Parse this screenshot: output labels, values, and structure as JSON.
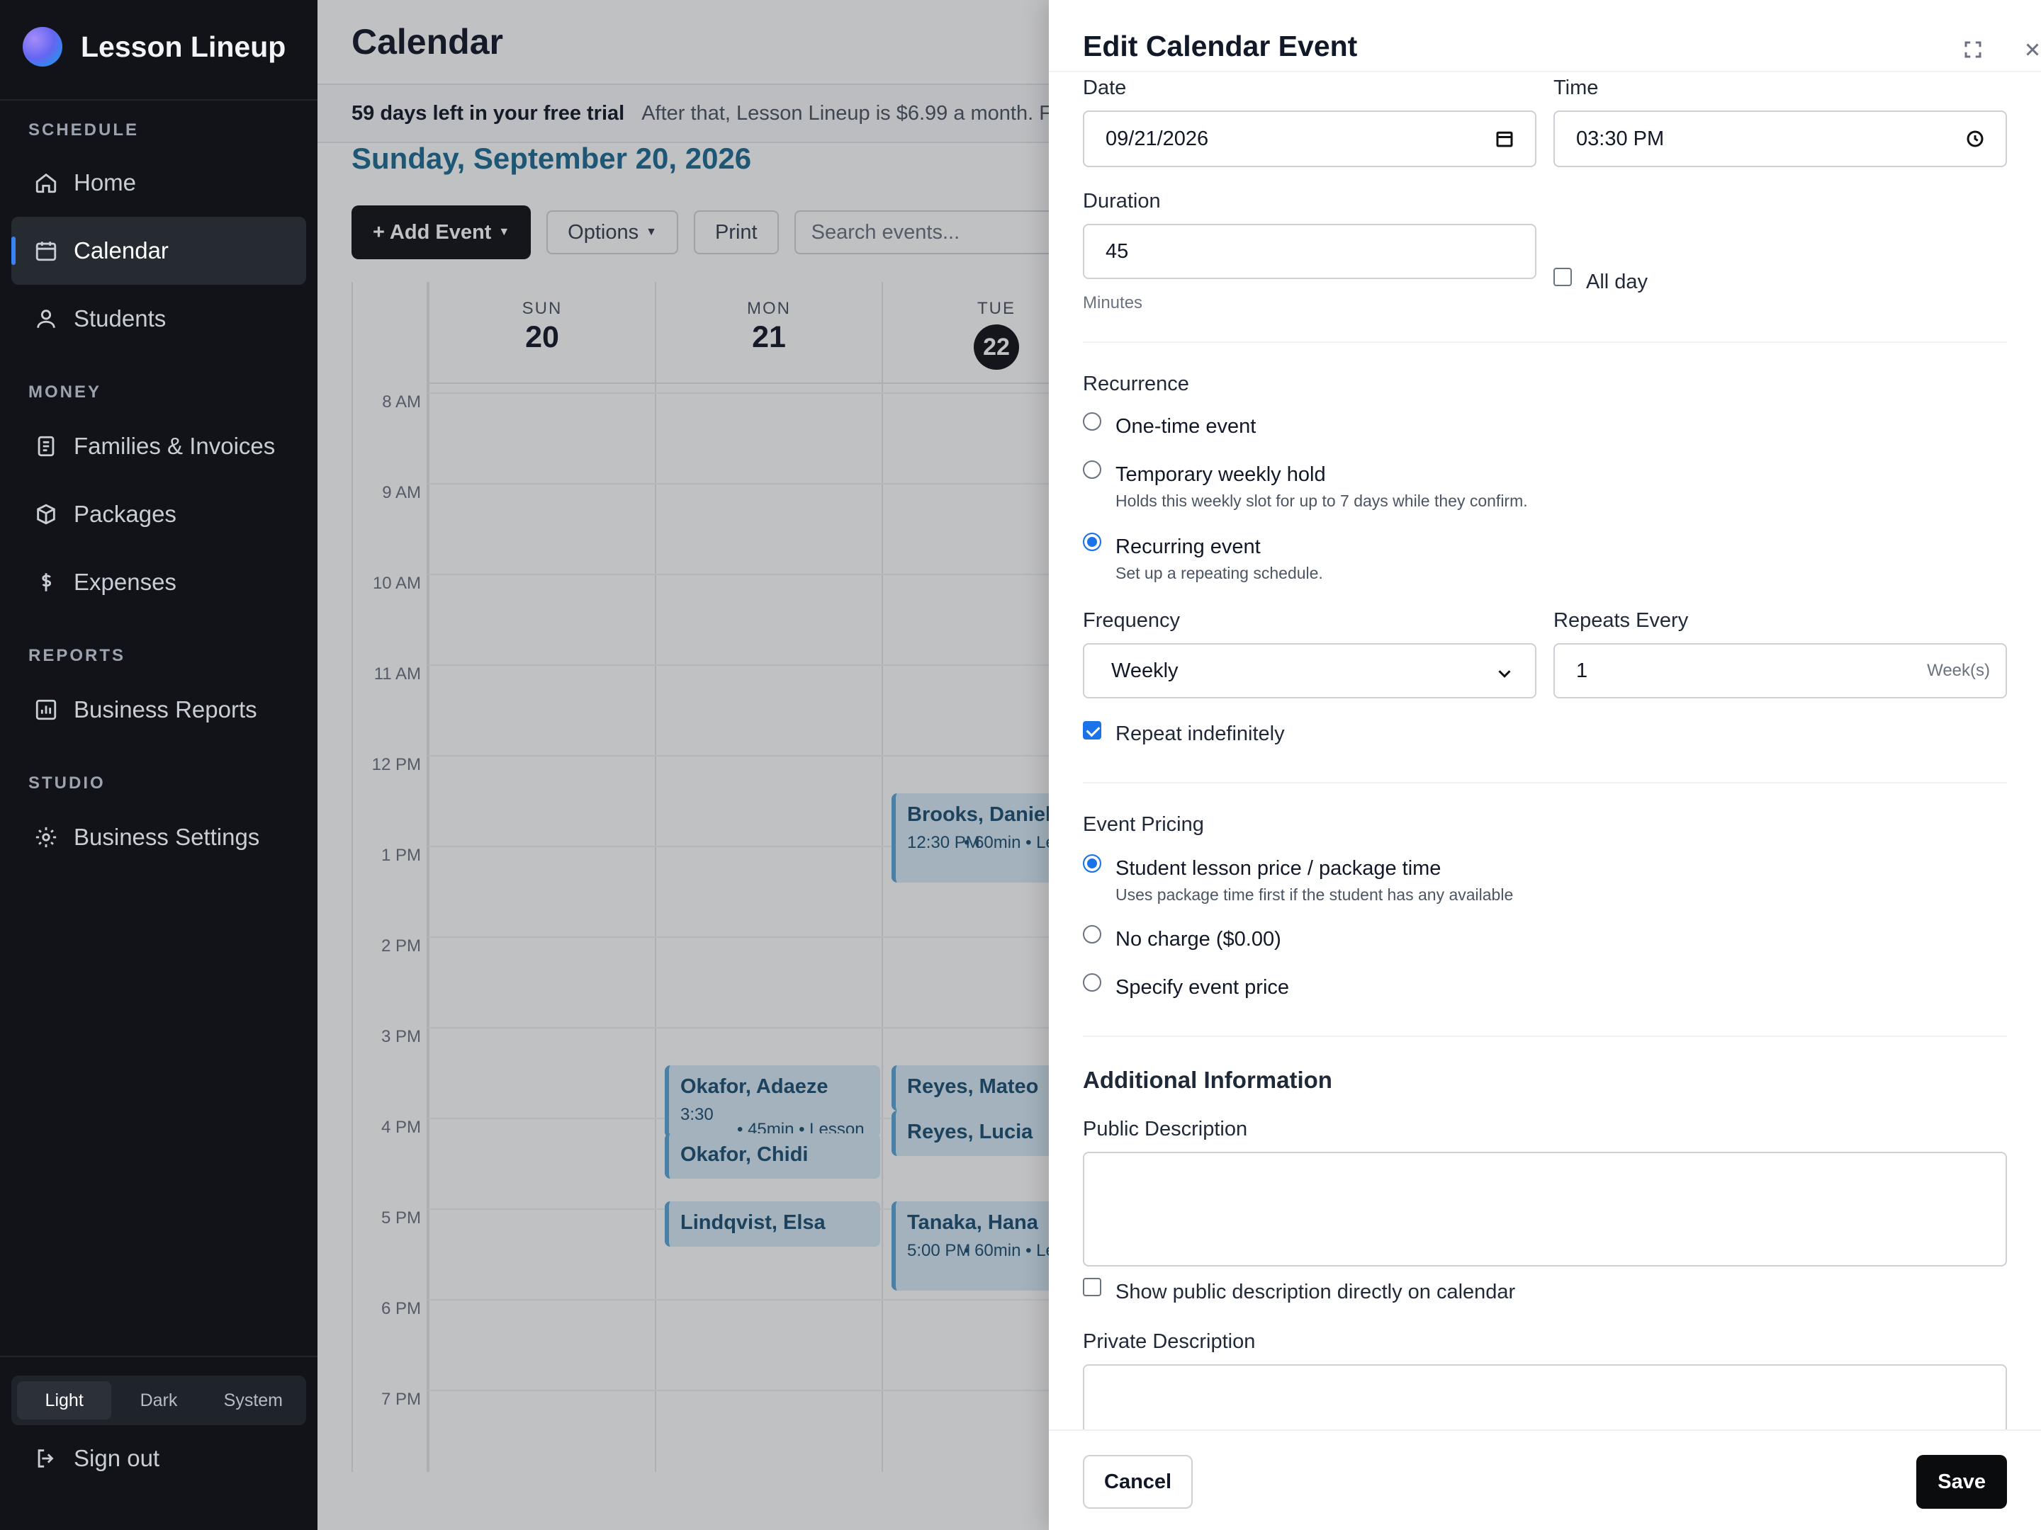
{
  "app": {
    "name": "Lesson Lineup"
  },
  "sidebar": {
    "sections": {
      "schedule": "SCHEDULE",
      "money": "MONEY",
      "reports": "REPORTS",
      "studio": "STUDIO"
    },
    "items": {
      "home": "Home",
      "calendar": "Calendar",
      "students": "Students",
      "families": "Families & Invoices",
      "packages": "Packages",
      "expenses": "Expenses",
      "business_reports": "Business Reports",
      "business_settings": "Business Settings"
    },
    "theme": {
      "light": "Light",
      "dark": "Dark",
      "system": "System",
      "selected": "Light"
    },
    "sign_out": "Sign out"
  },
  "main": {
    "title": "Calendar",
    "trial": {
      "bold": "59 days left in your free trial",
      "text": "After that, Lesson Lineup is $6.99 a month. F"
    },
    "date_heading": "Sunday, September 20, 2026",
    "toolbar": {
      "add_event": "+ Add Event",
      "options": "Options",
      "print": "Print",
      "search_placeholder": "Search events..."
    },
    "days": [
      {
        "name": "SUN",
        "num": "20",
        "today": false
      },
      {
        "name": "MON",
        "num": "21",
        "today": false
      },
      {
        "name": "TUE",
        "num": "22",
        "today": true
      }
    ],
    "hours": [
      "8 AM",
      "9 AM",
      "10 AM",
      "11 AM",
      "12 PM",
      "1 PM",
      "2 PM",
      "3 PM",
      "4 PM",
      "5 PM",
      "6 PM",
      "7 PM"
    ],
    "events": {
      "brooks": {
        "name": "Brooks, Daniel",
        "time": "12:30 PM",
        "meta": "• 60min • Le"
      },
      "okafor_a": {
        "name": "Okafor, Adaeze",
        "time": "3:30",
        "meta": "• 45min • Lesson"
      },
      "okafor_c": {
        "name": "Okafor, Chidi"
      },
      "lindqvist": {
        "name": "Lindqvist, Elsa"
      },
      "reyes_m": {
        "name": "Reyes, Mateo"
      },
      "reyes_l": {
        "name": "Reyes, Lucia"
      },
      "tanaka": {
        "name": "Tanaka, Hana",
        "time": "5:00 PM",
        "meta": "• 60min • Le"
      }
    }
  },
  "drawer": {
    "title": "Edit Calendar Event",
    "date_label": "Date",
    "date_value": "09/21/2026",
    "time_label": "Time",
    "time_value": "03:30  PM",
    "duration_label": "Duration",
    "duration_value": "45",
    "duration_hint": "Minutes",
    "all_day": "All day",
    "recurrence": {
      "title": "Recurrence",
      "one_time": "One-time event",
      "temp_hold": "Temporary weekly hold",
      "temp_hold_sub": "Holds this weekly slot for up to 7 days while they confirm.",
      "recurring": "Recurring event",
      "recurring_sub": "Set up a repeating schedule.",
      "selected": "Recurring event"
    },
    "frequency_label": "Frequency",
    "frequency_value": "Weekly",
    "repeats_label": "Repeats Every",
    "repeats_value": "1",
    "repeats_unit": "Week(s)",
    "repeat_indef": "Repeat indefinitely",
    "pricing": {
      "title": "Event Pricing",
      "student": "Student lesson price / package time",
      "student_sub": "Uses package time first if the student has any available",
      "no_charge": "No charge ($0.00)",
      "specify": "Specify event price",
      "selected": "Student lesson price / package time"
    },
    "additional_title": "Additional Information",
    "public_desc_label": "Public Description",
    "show_public": "Show public description directly on calendar",
    "private_desc_label": "Private Description",
    "cancel": "Cancel",
    "save": "Save"
  }
}
